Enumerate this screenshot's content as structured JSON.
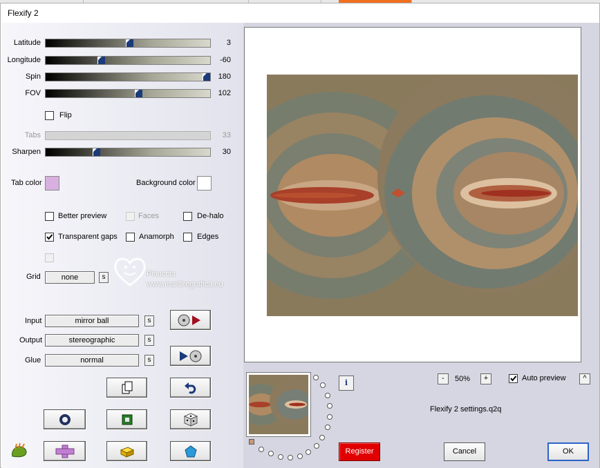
{
  "window": {
    "title": "Flexify 2"
  },
  "sliders": [
    {
      "label": "Latitude",
      "value": "3",
      "fraction": 0.51,
      "enabled": true
    },
    {
      "label": "Longitude",
      "value": "-60",
      "fraction": 0.33,
      "enabled": true
    },
    {
      "label": "Spin",
      "value": "180",
      "fraction": 1.0,
      "enabled": true
    },
    {
      "label": "FOV",
      "value": "102",
      "fraction": 0.57,
      "enabled": true
    },
    {
      "label": "Tabs",
      "value": "33",
      "fraction": 0.0,
      "enabled": false
    },
    {
      "label": "Sharpen",
      "value": "30",
      "fraction": 0.3,
      "enabled": true
    }
  ],
  "flip": {
    "label": "Flip",
    "checked": false
  },
  "colors": {
    "tab_color_label": "Tab color",
    "tab_color": "#d8b0e0",
    "background_color_label": "Background color",
    "background_color": "#ffffff"
  },
  "options": {
    "better_preview": {
      "label": "Better preview",
      "checked": false
    },
    "faces": {
      "label": "Faces",
      "checked": false,
      "enabled": false
    },
    "de_halo": {
      "label": "De-halo",
      "checked": false
    },
    "transparent_gaps": {
      "label": "Transparent gaps",
      "checked": true
    },
    "anamorph": {
      "label": "Anamorph",
      "checked": false
    },
    "edges": {
      "label": "Edges",
      "checked": false
    }
  },
  "grid": {
    "label": "Grid",
    "value": "none",
    "s_label": "s"
  },
  "watermark": {
    "line1": "Pinuccia",
    "line2": "www.maidiregrafica.eu"
  },
  "io": {
    "input": {
      "label": "Input",
      "value": "mirror ball",
      "s_label": "s"
    },
    "output": {
      "label": "Output",
      "value": "stereographic",
      "s_label": "s"
    },
    "glue": {
      "label": "Glue",
      "value": "normal",
      "s_label": "s"
    }
  },
  "preview_controls": {
    "zoom_minus": "-",
    "zoom_value": "50%",
    "zoom_plus": "+",
    "auto_preview_label": "Auto preview",
    "auto_preview_checked": true,
    "expand": "^",
    "settings_file": "Flexify 2 settings.q2q",
    "info": "i"
  },
  "buttons": {
    "register": "Register",
    "cancel": "Cancel",
    "ok": "OK"
  },
  "accent_colors": {
    "register": "#e00000",
    "ok_border": "#2b63c6",
    "slider_thumb": "#1a3a7a"
  }
}
